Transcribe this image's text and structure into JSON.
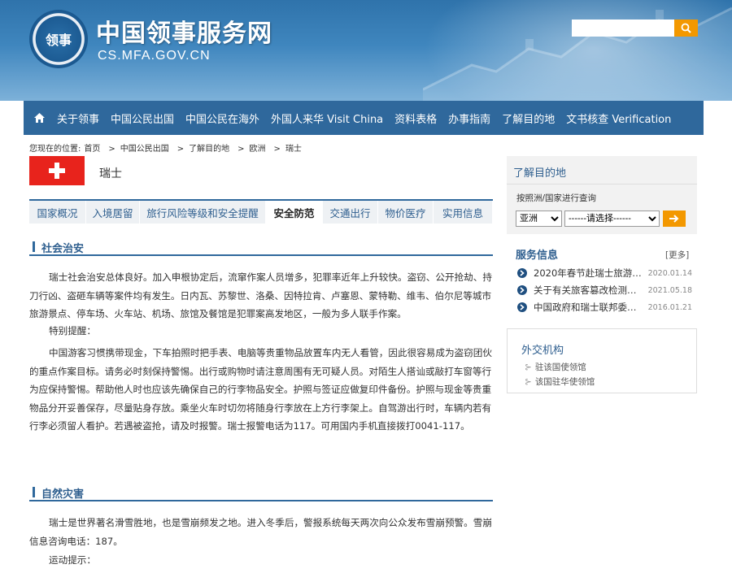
{
  "header": {
    "logo_text": "领事",
    "site_title": "中国领事服务网",
    "site_url": "CS.MFA.GOV.CN",
    "search_placeholder": ""
  },
  "nav": {
    "items": [
      {
        "label": "关于领事"
      },
      {
        "label": "中国公民出国"
      },
      {
        "label": "中国公民在海外"
      },
      {
        "label": "外国人来华 Visit China"
      },
      {
        "label": "资料表格"
      },
      {
        "label": "办事指南"
      },
      {
        "label": "了解目的地"
      },
      {
        "label": "文书核查 Verification"
      }
    ]
  },
  "breadcrumb": {
    "prefix": "您现在的位置:",
    "items": [
      "首页",
      "中国公民出国",
      "了解目的地",
      "欧洲",
      "瑞士"
    ]
  },
  "country": {
    "name": "瑞士"
  },
  "tabs": [
    {
      "label": "国家概况"
    },
    {
      "label": "入境居留"
    },
    {
      "label": "旅行风险等级和安全提醒"
    },
    {
      "label": "安全防范"
    },
    {
      "label": "交通出行"
    },
    {
      "label": "物价医疗"
    },
    {
      "label": "实用信息"
    }
  ],
  "sections": {
    "security": {
      "title": "社会治安",
      "p1": "瑞士社会治安总体良好。加入申根协定后，流窜作案人员增多，犯罪率近年上升较快。盗窃、公开抢劫、持刀行凶、盗砸车辆等案件均有发生。日内瓦、苏黎世、洛桑、因特拉肯、卢塞恩、蒙特勒、维韦、伯尔尼等城市旅游景点、停车场、火车站、机场、旅馆及餐馆是犯罪案高发地区，一般为多人联手作案。",
      "p2": "特别提醒：",
      "p3": "中国游客习惯携带现金，下车拍照时把手表、电脑等贵重物品放置车内无人看管，因此很容易成为盗窃团伙的重点作案目标。请务必时刻保持警惕。出行或购物时请注意周围有无可疑人员。对陌生人搭讪或敲打车窗等行为应保持警惕。帮助他人时也应该先确保自己的行李物品安全。护照与签证应做复印件备份。护照与现金等贵重物品分开妥善保存，尽量贴身存放。乘坐火车时切勿将随身行李放在上方行李架上。自驾游出行时，车辆内若有行李必须留人看护。若遇被盗抢，请及时报警。瑞士报警电话为117。可用国内手机直接拨打0041-117。"
    },
    "disaster": {
      "title": "自然灾害",
      "p1": "瑞士是世界著名滑雪胜地，也是雪崩频发之地。进入冬季后，警报系统每天两次向公众发布雪崩预警。雪崩信息咨询电话：187。",
      "p2": "运动提示："
    }
  },
  "sidebar": {
    "destination": {
      "title": "了解目的地",
      "query_label": "按照洲/国家进行查询",
      "continent_selected": "亚洲",
      "country_selected": "------请选择------"
    },
    "services": {
      "title": "服务信息",
      "more": "[更多]",
      "items": [
        {
          "title": "2020年春节赴瑞士旅游…",
          "date": "2020.01.14"
        },
        {
          "title": "关于有关旅客篡改检测…",
          "date": "2021.05.18"
        },
        {
          "title": "中国政府和瑞士联邦委…",
          "date": "2016.01.21"
        }
      ]
    },
    "foreign": {
      "title": "外交机构",
      "links": [
        "驻该国使领馆",
        "该国驻华使领馆"
      ]
    }
  },
  "colors": {
    "nav_bg": "#2f689c",
    "accent_orange": "#f39800",
    "flag_red": "#e8231c"
  }
}
